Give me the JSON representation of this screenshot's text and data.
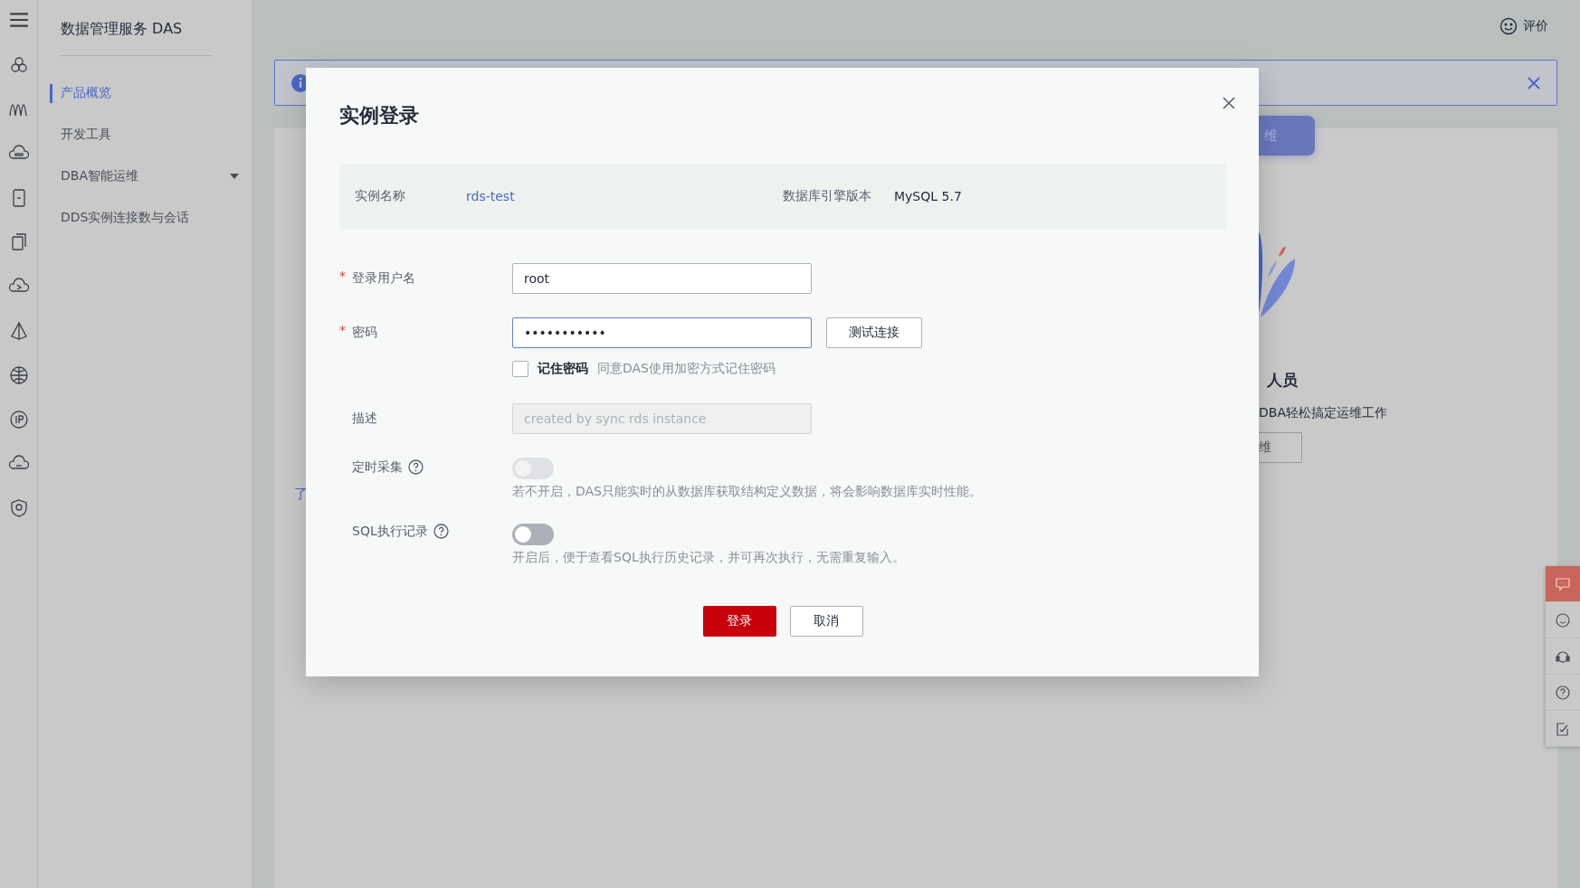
{
  "top_bar": {
    "feedback": "评价"
  },
  "nav": {
    "title": "数据管理服务 DAS",
    "items": [
      {
        "label": "产品概览",
        "selected": true,
        "has_submenu": false
      },
      {
        "label": "开发工具",
        "selected": false,
        "has_submenu": false
      },
      {
        "label": "DBA智能运维",
        "selected": false,
        "has_submenu": true
      },
      {
        "label": "DDS实例连接数与会话",
        "selected": false,
        "has_submenu": false
      }
    ]
  },
  "background": {
    "tab_button": "维",
    "heading": "人员",
    "description": "DBA轻松搞定运维工作",
    "button": "维",
    "link": "了"
  },
  "dialog": {
    "title": "实例登录",
    "info": [
      {
        "label": "实例名称",
        "value": "rds-test",
        "kind": "link"
      },
      {
        "label": "数据库引擎版本",
        "value": "MySQL 5.7",
        "kind": "text"
      }
    ],
    "username": {
      "label": "登录用户名",
      "required_mark": "*",
      "value": "root",
      "focused": false
    },
    "password": {
      "label": "密码",
      "required_mark": "*",
      "value": "•••••••••••",
      "focused": true,
      "test_button": "测试连接"
    },
    "remember": {
      "label": "记住密码",
      "hint": "同意DAS使用加密方式记住密码",
      "checked": false
    },
    "description": {
      "label": "描述",
      "placeholder": "created by sync rds instance",
      "disabled": true
    },
    "toggles": [
      {
        "label": "定时采集",
        "on": false,
        "disabled": true,
        "hint": "若不开启，DAS只能实时的从数据库获取结构定义数据，将会影响数据库实时性能。"
      },
      {
        "label": "SQL执行记录",
        "on": false,
        "disabled": false,
        "hint": "开启后，便于查看SQL执行历史记录，并可再次执行，无需重复输入。"
      }
    ],
    "login_button": "登录",
    "cancel_button": "取消"
  },
  "float_bar": [
    {
      "selected": true
    },
    {
      "selected": false
    },
    {
      "selected": false
    },
    {
      "selected": false
    },
    {
      "selected": false
    }
  ]
}
